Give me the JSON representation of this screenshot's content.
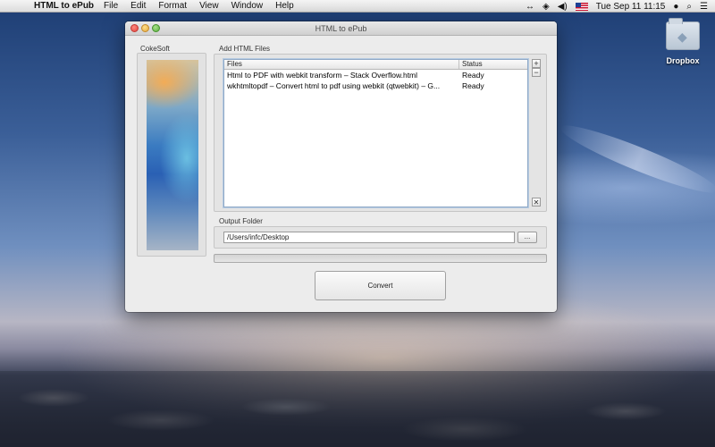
{
  "menubar": {
    "app_name": "HTML to ePub",
    "items": [
      "File",
      "Edit",
      "Format",
      "View",
      "Window",
      "Help"
    ],
    "clock": "Tue Sep 11  11:15"
  },
  "desktop": {
    "icon_label": "Dropbox"
  },
  "window": {
    "title": "HTML to ePub",
    "brand_label": "CokeSoft",
    "files_section_label": "Add HTML Files",
    "table": {
      "columns": [
        "Files",
        "Status"
      ],
      "rows": [
        {
          "file": "Html to PDF with webkit transform – Stack Overflow.html",
          "status": "Ready"
        },
        {
          "file": "wkhtmltopdf – Convert html to pdf using webkit (qtwebkit) – G...",
          "status": "Ready"
        }
      ]
    },
    "add_label": "+",
    "remove_label": "−",
    "clear_label": "✕",
    "output_section_label": "Output Folder",
    "output_path": "/Users/infc/Desktop",
    "browse_label": "...",
    "progress": 0,
    "convert_label": "Convert"
  },
  "colors": {
    "accent": "#3f7fd6",
    "window_bg": "#ececec"
  }
}
